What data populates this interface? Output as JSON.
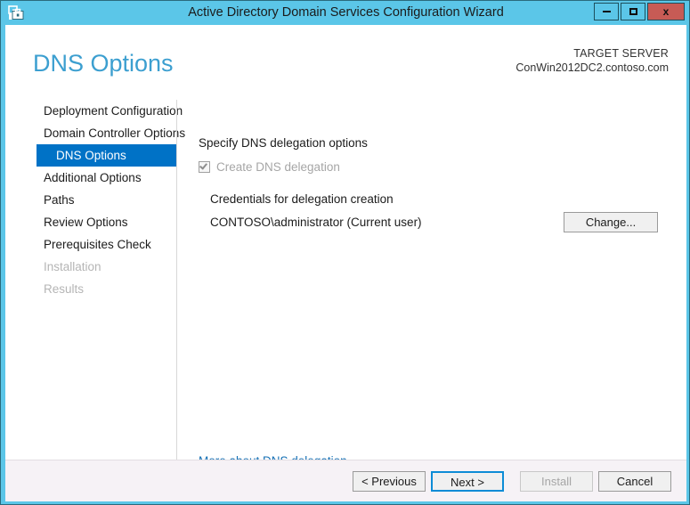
{
  "window": {
    "title": "Active Directory Domain Services Configuration Wizard",
    "icon": "server-manager-toolbox-icon",
    "controls": {
      "minimize": "Minimize",
      "maximize": "Maximize",
      "close": "x"
    },
    "colors": {
      "titlebar": "#5bc6e8",
      "close_button": "#c75b55",
      "accent_blue": "#0072c6",
      "title_text_blue": "#3c9fd0",
      "link_blue": "#1570b5",
      "footer_background": "#f6f2f6"
    }
  },
  "header": {
    "page_title": "DNS Options",
    "target_server_label": "TARGET SERVER",
    "target_server_name": "ConWin2012DC2.contoso.com"
  },
  "sidebar": {
    "items": [
      {
        "label": "Deployment Configuration",
        "state": "enabled"
      },
      {
        "label": "Domain Controller Options",
        "state": "enabled"
      },
      {
        "label": "DNS Options",
        "state": "selected"
      },
      {
        "label": "Additional Options",
        "state": "enabled"
      },
      {
        "label": "Paths",
        "state": "enabled"
      },
      {
        "label": "Review Options",
        "state": "enabled"
      },
      {
        "label": "Prerequisites Check",
        "state": "enabled"
      },
      {
        "label": "Installation",
        "state": "disabled"
      },
      {
        "label": "Results",
        "state": "disabled"
      }
    ]
  },
  "main": {
    "specify_label": "Specify DNS delegation options",
    "create_delegation": {
      "label": "Create DNS delegation",
      "checked": true,
      "enabled": false
    },
    "credentials_label": "Credentials for delegation creation",
    "credentials_value": "CONTOSO\\administrator (Current user)",
    "change_button": "Change...",
    "more_about_link": "More about DNS delegation"
  },
  "footer": {
    "previous_button": "< Previous",
    "next_button": "Next >",
    "install_button": "Install",
    "cancel_button": "Cancel"
  }
}
